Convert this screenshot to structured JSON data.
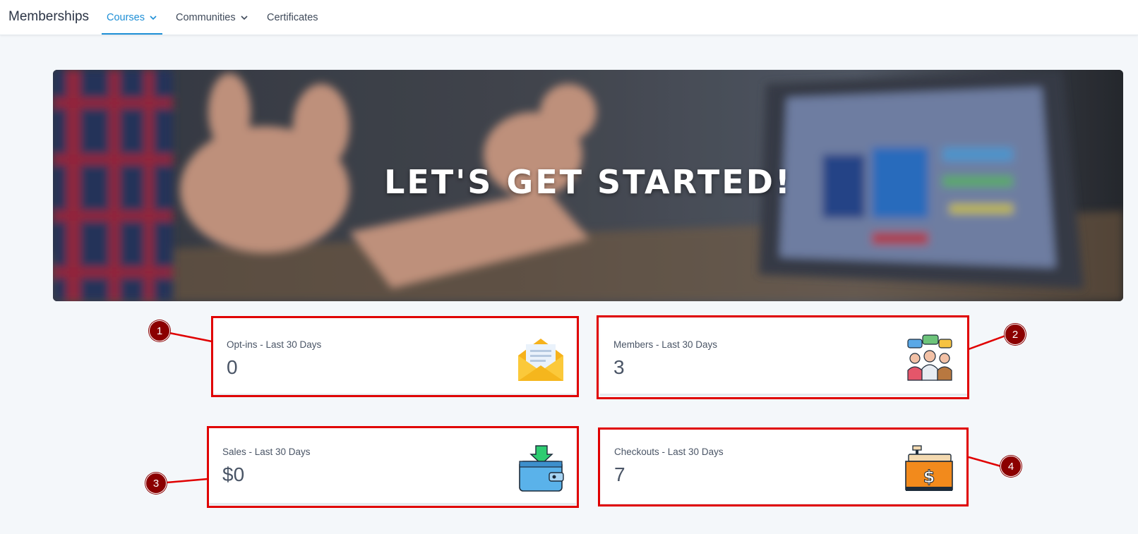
{
  "app": {
    "brand": "Memberships"
  },
  "nav": {
    "items": [
      {
        "label": "Courses",
        "active": true,
        "has_dropdown": true
      },
      {
        "label": "Communities",
        "active": false,
        "has_dropdown": true
      },
      {
        "label": "Certificates",
        "active": false,
        "has_dropdown": false
      }
    ]
  },
  "hero": {
    "title": "LET'S GET STARTED!"
  },
  "stats": [
    {
      "label": "Opt-ins - Last 30 Days",
      "value": "0",
      "icon": "envelope-icon"
    },
    {
      "label": "Members - Last 30 Days",
      "value": "3",
      "icon": "members-icon"
    },
    {
      "label": "Sales - Last 30 Days",
      "value": "$0",
      "icon": "wallet-icon"
    },
    {
      "label": "Checkouts - Last 30 Days",
      "value": "7",
      "icon": "cash-register-icon"
    }
  ],
  "annotations": {
    "markers": [
      "1",
      "2",
      "3",
      "4"
    ]
  },
  "colors": {
    "accent": "#1e8fd6",
    "highlight": "#e00000",
    "marker": "#8b0000",
    "background": "#f4f7fa"
  }
}
